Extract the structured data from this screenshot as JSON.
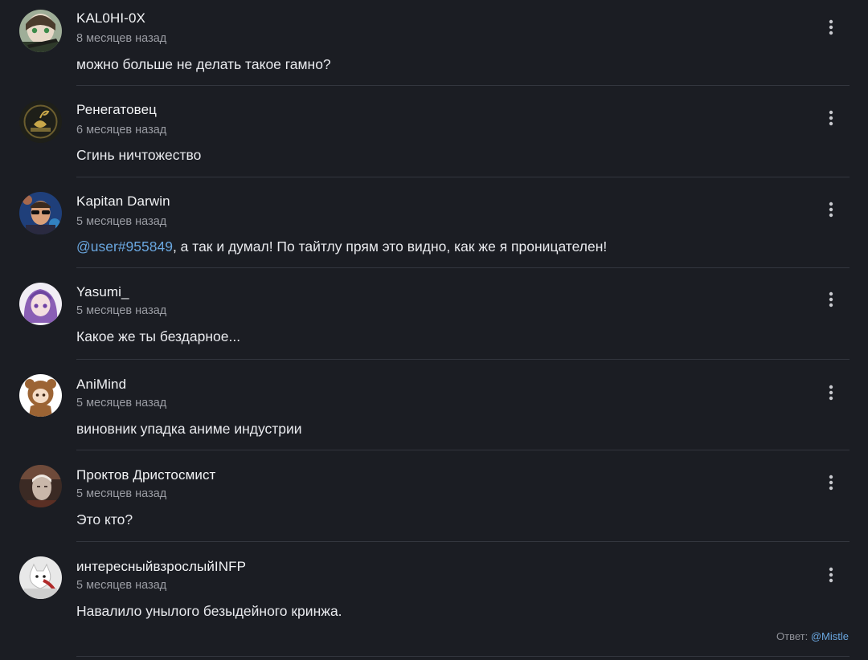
{
  "comments": [
    {
      "author": "KAL0HI-0X",
      "time": "8 месяцев назад",
      "text": "можно больше не делать такое гамно?",
      "avatar_icon": "anime-girl-avatar",
      "avatar_colors": [
        "#b9c7b2",
        "#3a4a35"
      ]
    },
    {
      "author": "Ренегатовец",
      "time": "6 месяцев назад",
      "text": "Сгинь ничтожество",
      "avatar_icon": "scorpion-emblem-avatar",
      "avatar_colors": [
        "#2a2a22",
        "#c9a84a"
      ]
    },
    {
      "author": "Kapitan Darwin",
      "time": "5 месяцев назад",
      "mention": "@user#955849",
      "text": ", а так и думал! По тайтлу прям это видно, как же я проницателен!",
      "avatar_icon": "man-sunglasses-avatar",
      "avatar_colors": [
        "#1f3f7a",
        "#e07a3a"
      ]
    },
    {
      "author": "Yasumi_",
      "time": "5 месяцев назад",
      "text": "Какое же ты бездарное...",
      "avatar_icon": "purple-hair-anime-avatar",
      "avatar_colors": [
        "#f1eef5",
        "#8a5fb5"
      ]
    },
    {
      "author": "AniMind",
      "time": "5 месяцев назад",
      "text": "виновник упадка аниме индустрии",
      "avatar_icon": "bear-costume-avatar",
      "avatar_colors": [
        "#ffffff",
        "#9c6434"
      ]
    },
    {
      "author": "Проктов Дристосмист",
      "time": "5 месяцев назад",
      "text": "Это кто?",
      "avatar_icon": "face-photo-avatar",
      "avatar_colors": [
        "#3b2a24",
        "#c9b7aa"
      ]
    },
    {
      "author": "интересныйвзрослыйINFP",
      "time": "5 месяцев назад",
      "text": "Навалило унылого безыдейного кринжа.",
      "avatar_icon": "cat-red-avatar",
      "avatar_colors": [
        "#e8e8e8",
        "#b02a2a"
      ],
      "reply_prefix": "Ответ:",
      "reply_to": "@Mistle"
    }
  ],
  "menu_icon": "vertical-dots-icon",
  "colors": {
    "background": "#1b1d23",
    "mention": "#6aa7e0",
    "muted": "#9a9ca3",
    "divider": "#33363e"
  }
}
